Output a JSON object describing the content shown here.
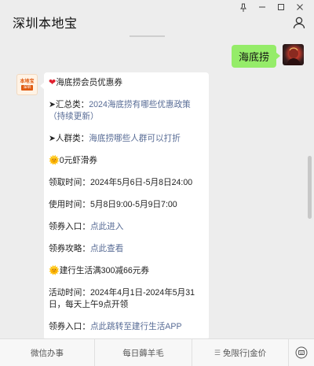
{
  "window": {
    "title": "深圳本地宝",
    "controls": [
      "pin-icon",
      "minimize-icon",
      "maximize-icon",
      "close-icon"
    ]
  },
  "chat": {
    "sent_message": "海底捞",
    "card": {
      "title": "海底捞会员优惠券",
      "summary_label": "➤汇总类：",
      "summary_link": "2024海底捞有哪些优惠政策（持续更新）",
      "crowd_label": "➤人群类：",
      "crowd_link": "海底捞哪些人群可以打折",
      "coupon1_title": "0元虾滑券",
      "claim_time": "领取时间：2024年5月6日-5月8日24:00",
      "use_time": "使用时间：5月8日9:00-5月9日7:00",
      "entry1_label": "领券入口：",
      "entry1_link": "点此进入",
      "guide_label": "领券攻略：",
      "guide_link": "点此查看",
      "coupon2_title": "建行生活满300减66元券",
      "activity_time": "活动时间：2024年4月1日-2024年5月31日，每天上午9点开领",
      "entry2_label": "领券入口：",
      "entry2_link": "点此跳转至建行生活APP"
    },
    "bot_avatar_text": [
      "本地宝",
      "深圳"
    ]
  },
  "bottom_menu": {
    "items": [
      "微信办事",
      "每日薅羊毛",
      "免限行|金价"
    ],
    "keyboard_icon": "keyboard-icon"
  },
  "colors": {
    "background": "#ededed",
    "sent_bubble": "#95ec69",
    "link": "#576b95",
    "heart": "#e0202f",
    "sun": "#f5b100"
  }
}
